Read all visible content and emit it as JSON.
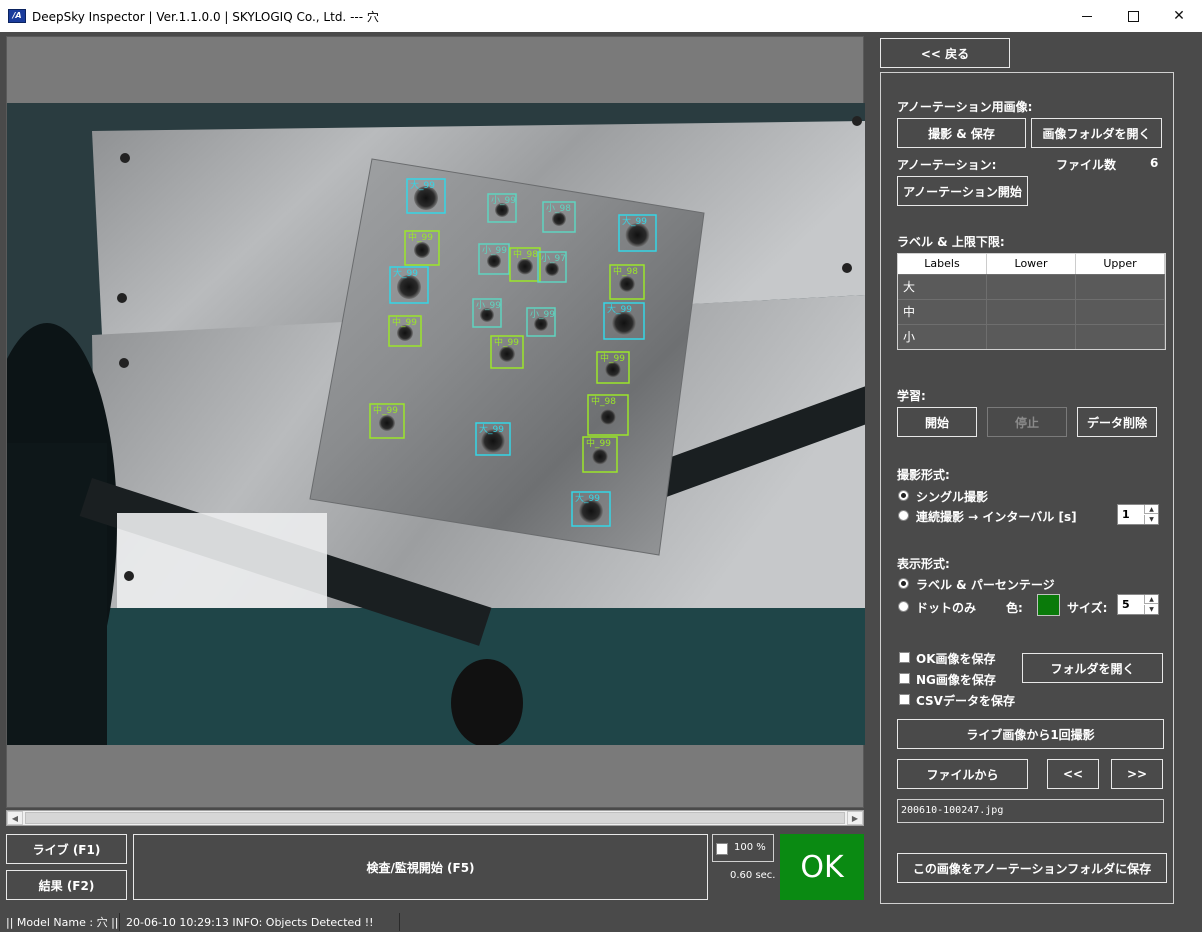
{
  "window": {
    "title": "DeepSky Inspector | Ver.1.1.0.0 | SKYLOGIQ Co., Ltd. --- 穴"
  },
  "detections": [
    {
      "label": "大_99",
      "cls": "dai"
    },
    {
      "label": "小_99",
      "cls": "sho"
    },
    {
      "label": "小_98",
      "cls": "sho"
    },
    {
      "label": "大_99",
      "cls": "dai"
    },
    {
      "label": "中_99",
      "cls": "chu"
    },
    {
      "label": "小_99",
      "cls": "sho"
    },
    {
      "label": "中_98",
      "cls": "chu"
    },
    {
      "label": "小_97",
      "cls": "sho"
    },
    {
      "label": "大_99",
      "cls": "dai"
    },
    {
      "label": "中_98",
      "cls": "chu"
    },
    {
      "label": "小_99",
      "cls": "sho"
    },
    {
      "label": "小_99",
      "cls": "sho"
    },
    {
      "label": "大_99",
      "cls": "dai"
    },
    {
      "label": "中_99",
      "cls": "chu"
    },
    {
      "label": "中_99",
      "cls": "chu"
    },
    {
      "label": "中_99",
      "cls": "chu"
    },
    {
      "label": "中_99",
      "cls": "chu"
    },
    {
      "label": "大_99",
      "cls": "dai"
    },
    {
      "label": "中_98",
      "cls": "chu"
    },
    {
      "label": "中_99",
      "cls": "chu"
    },
    {
      "label": "大_99",
      "cls": "dai"
    }
  ],
  "colors": {
    "dai": "#35d6e6",
    "chu": "#9be62a",
    "sho": "#5fd4c0",
    "ok": "#0a8a12"
  },
  "bottom": {
    "live_btn": "ライブ (F1)",
    "result_btn": "結果 (F2)",
    "inspect_btn": "検査/監視開始 (F5)",
    "zoom": "100 %",
    "time": "0.60 sec.",
    "ok": "OK"
  },
  "status": {
    "model": "|| Model Name : 穴 ||",
    "message": "20-06-10 10:29:13   INFO:   Objects Detected !!"
  },
  "panel": {
    "back_btn": "<< 戻る",
    "annot_image_label": "アノーテーション用画像:",
    "capture_save_btn": "撮影 & 保存",
    "open_image_folder_btn": "画像フォルダを開く",
    "annot_label": "アノーテーション:",
    "file_count_label": "ファイル数",
    "file_count": "6",
    "annot_start_btn": "アノーテーション開始",
    "labels_limits_label": "ラベル & 上限下限:",
    "table_headers": [
      "Labels",
      "Lower",
      "Upper"
    ],
    "table_rows": [
      {
        "label": "大",
        "lower": "",
        "upper": ""
      },
      {
        "label": "中",
        "lower": "",
        "upper": ""
      },
      {
        "label": "小",
        "lower": "",
        "upper": ""
      }
    ],
    "learning_label": "学習:",
    "start_btn": "開始",
    "stop_btn": "停止",
    "delete_data_btn": "データ削除",
    "capture_mode_label": "撮影形式:",
    "single_capture": "シングル撮影",
    "continuous_capture": "連続撮影 → インターバル [s]",
    "interval_value": "1",
    "display_mode_label": "表示形式:",
    "label_percentage": "ラベル & パーセンテージ",
    "dot_only": "ドットのみ",
    "color_label": "色:",
    "size_label": "サイズ:",
    "size_value": "5",
    "save_ok": "OK画像を保存",
    "save_ng": "NG画像を保存",
    "save_csv": "CSVデータを保存",
    "open_folder_btn": "フォルダを開く",
    "capture_once_btn": "ライブ画像から1回撮影",
    "from_file_btn": "ファイルから",
    "prev_btn": "<<",
    "next_btn": ">>",
    "file_name": "200610-100247.jpg",
    "save_to_annot_btn": "この画像をアノーテーションフォルダに保存"
  }
}
